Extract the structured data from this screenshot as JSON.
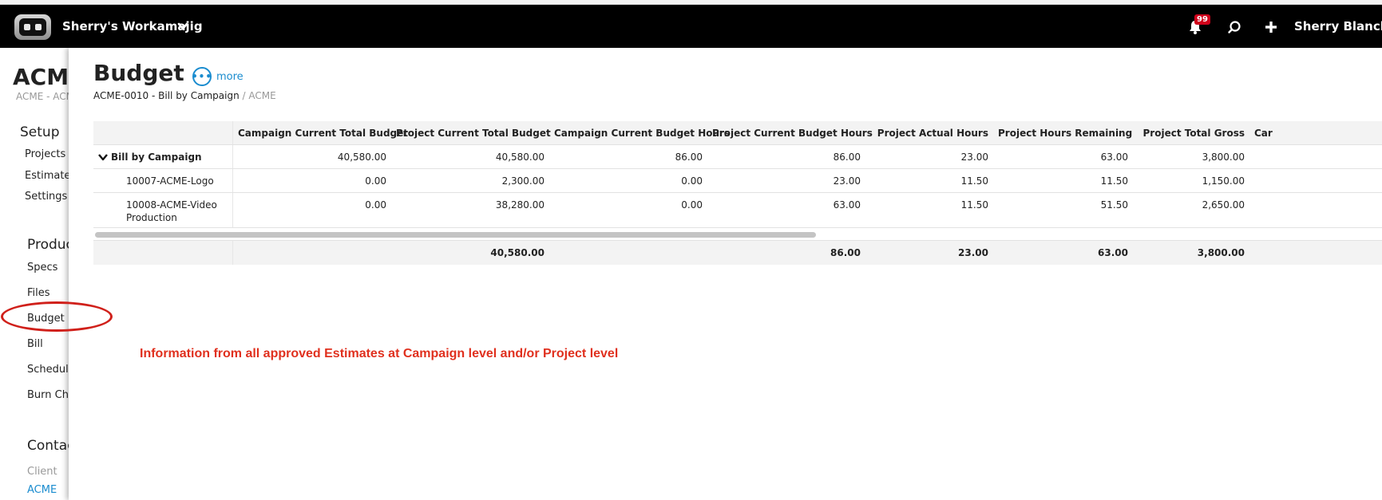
{
  "header": {
    "workspace_name": "Sherry's Workamajig",
    "notification_count": "99",
    "user_name": "Sherry Blanche"
  },
  "sidebar": {
    "title": "ACME",
    "subtitle": "ACME - ACME",
    "sections": [
      {
        "label": "Setup",
        "items": [
          "Projects A",
          "Estimates",
          "Settings"
        ]
      },
      {
        "label": "Produc",
        "items": [
          "Specs",
          "Files",
          "Budget",
          "Bill",
          "Schedule",
          "Burn Cha"
        ]
      },
      {
        "label": "Contac",
        "items": [
          "Client",
          "ACME"
        ]
      }
    ]
  },
  "page": {
    "title": "Budget",
    "more_label": "more",
    "breadcrumb_main": "ACME-0010 - Bill by Campaign",
    "breadcrumb_sep": " / ",
    "breadcrumb_sub": "ACME"
  },
  "table": {
    "columns": [
      "Campaign Current Total Budget",
      "Project Current Total Budget",
      "Campaign Current Budget Hours",
      "Project Current Budget Hours",
      "Project Actual Hours",
      "Project Hours Remaining",
      "Project Total Gross",
      "Car"
    ],
    "group": {
      "name": "Bill by Campaign",
      "values": [
        "40,580.00",
        "40,580.00",
        "86.00",
        "86.00",
        "23.00",
        "63.00",
        "3,800.00"
      ]
    },
    "rows": [
      {
        "name": "10007-ACME-Logo",
        "values": [
          "0.00",
          "2,300.00",
          "0.00",
          "23.00",
          "11.50",
          "11.50",
          "1,150.00"
        ]
      },
      {
        "name": "10008-ACME-Video Production",
        "values": [
          "0.00",
          "38,280.00",
          "0.00",
          "63.00",
          "11.50",
          "51.50",
          "2,650.00"
        ]
      }
    ],
    "totals": [
      "",
      "40,580.00",
      "",
      "86.00",
      "23.00",
      "63.00",
      "3,800.00"
    ]
  },
  "annotation": {
    "text": "Information from all approved Estimates at Campaign level and/or Project level",
    "color": "#e0301e"
  },
  "colors": {
    "accent": "#1a8ccf",
    "header_bg": "#000000",
    "annotation_red": "#e0301e"
  }
}
